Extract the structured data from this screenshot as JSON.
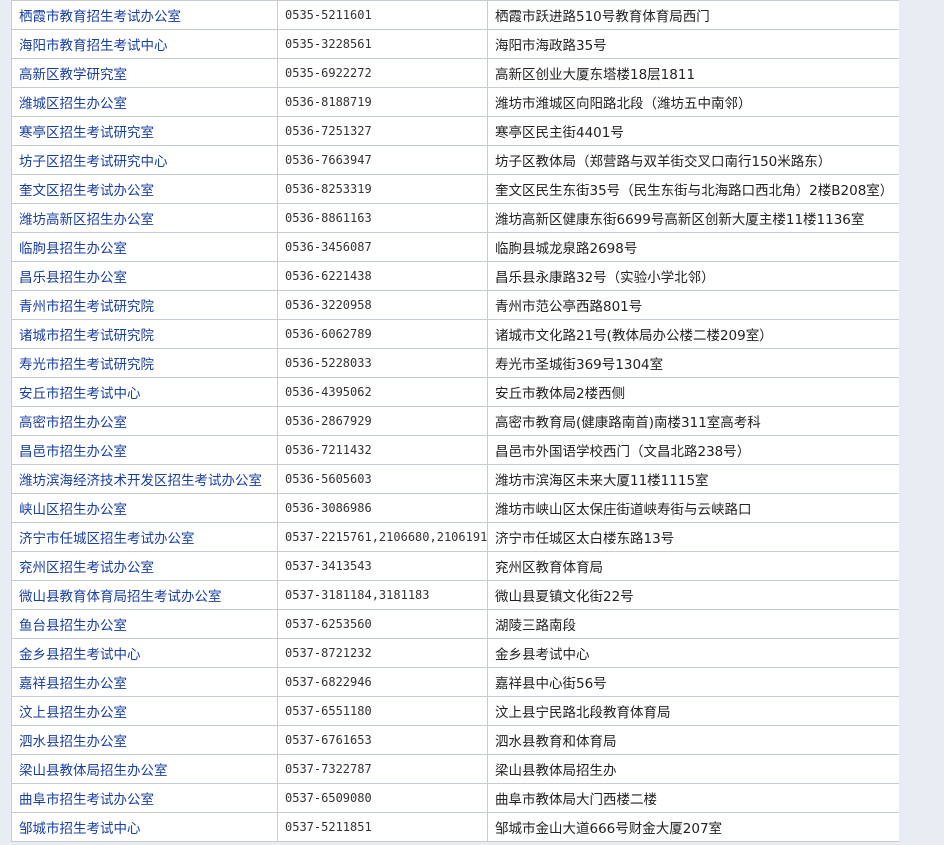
{
  "rows": [
    {
      "name": "栖霞市教育招生考试办公室",
      "phone": "0535-5211601",
      "address": "栖霞市跃进路510号教育体育局西门"
    },
    {
      "name": "海阳市教育招生考试中心",
      "phone": "0535-3228561",
      "address": "海阳市海政路35号"
    },
    {
      "name": "高新区教学研究室",
      "phone": "0535-6922272",
      "address": "高新区创业大厦东塔楼18层1811"
    },
    {
      "name": "潍城区招生办公室",
      "phone": "0536-8188719",
      "address": "潍坊市潍城区向阳路北段（潍坊五中南邻）"
    },
    {
      "name": "寒亭区招生考试研究室",
      "phone": "0536-7251327",
      "address": "寒亭区民主街4401号"
    },
    {
      "name": "坊子区招生考试研究中心",
      "phone": "0536-7663947",
      "address": "坊子区教体局（郑营路与双羊街交叉口南行150米路东）"
    },
    {
      "name": "奎文区招生考试办公室",
      "phone": "0536-8253319",
      "address": "奎文区民生东街35号（民生东街与北海路口西北角）2楼B208室）"
    },
    {
      "name": "潍坊高新区招生办公室",
      "phone": "0536-8861163",
      "address": "潍坊高新区健康东街6699号高新区创新大厦主楼11楼1136室"
    },
    {
      "name": "临朐县招生办公室",
      "phone": "0536-3456087",
      "address": "临朐县城龙泉路2698号"
    },
    {
      "name": "昌乐县招生办公室",
      "phone": "0536-6221438",
      "address": "昌乐县永康路32号（实验小学北邻）"
    },
    {
      "name": "青州市招生考试研究院",
      "phone": "0536-3220958",
      "address": "青州市范公亭西路801号"
    },
    {
      "name": "诸城市招生考试研究院",
      "phone": "0536-6062789",
      "address": "诸城市文化路21号(教体局办公楼二楼209室）"
    },
    {
      "name": "寿光市招生考试研究院",
      "phone": "0536-5228033",
      "address": "寿光市圣城街369号1304室"
    },
    {
      "name": "安丘市招生考试中心",
      "phone": "0536-4395062",
      "address": "安丘市教体局2楼西侧"
    },
    {
      "name": "高密市招生办公室",
      "phone": "0536-2867929",
      "address": "高密市教育局(健康路南首)南楼311室高考科"
    },
    {
      "name": "昌邑市招生办公室",
      "phone": "0536-7211432",
      "address": "昌邑市外国语学校西门（文昌北路238号）"
    },
    {
      "name": "潍坊滨海经济技术开发区招生考试办公室",
      "phone": "0536-5605603",
      "address": "潍坊市滨海区未来大厦11楼1115室"
    },
    {
      "name": "峡山区招生办公室",
      "phone": "0536-3086986",
      "address": "潍坊市峡山区太保庄街道峡寿街与云峡路口"
    },
    {
      "name": "济宁市任城区招生考试办公室",
      "phone": "0537-2215761,2106680,2106191",
      "address": "济宁市任城区太白楼东路13号"
    },
    {
      "name": "兖州区招生考试办公室",
      "phone": "0537-3413543",
      "address": "兖州区教育体育局"
    },
    {
      "name": "微山县教育体育局招生考试办公室",
      "phone": "0537-3181184,3181183",
      "address": "微山县夏镇文化街22号"
    },
    {
      "name": "鱼台县招生办公室",
      "phone": "0537-6253560",
      "address": "湖陵三路南段"
    },
    {
      "name": "金乡县招生考试中心",
      "phone": "0537-8721232",
      "address": "金乡县考试中心"
    },
    {
      "name": "嘉祥县招生办公室",
      "phone": "0537-6822946",
      "address": "嘉祥县中心街56号"
    },
    {
      "name": "汶上县招生办公室",
      "phone": "0537-6551180",
      "address": "汶上县宁民路北段教育体育局"
    },
    {
      "name": "泗水县招生办公室",
      "phone": "0537-6761653",
      "address": "泗水县教育和体育局"
    },
    {
      "name": "梁山县教体局招生办公室",
      "phone": "0537-7322787",
      "address": "梁山县教体局招生办"
    },
    {
      "name": "曲阜市招生考试办公室",
      "phone": "0537-6509080",
      "address": "曲阜市教体局大门西楼二楼"
    },
    {
      "name": "邹城市招生考试中心",
      "phone": "0537-5211851",
      "address": "邹城市金山大道666号财金大厦207室"
    }
  ]
}
